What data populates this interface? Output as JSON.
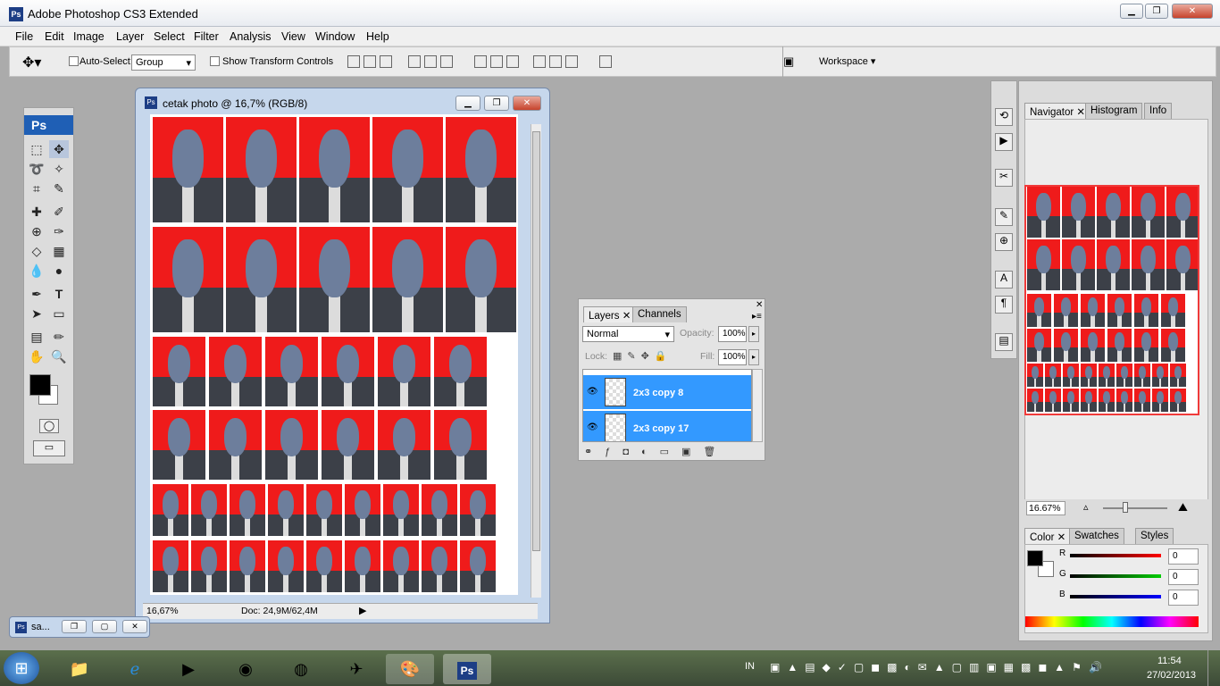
{
  "window": {
    "title": "Adobe Photoshop CS3 Extended",
    "app_icon": "Ps"
  },
  "menu": [
    "File",
    "Edit",
    "Image",
    "Layer",
    "Select",
    "Filter",
    "Analysis",
    "View",
    "Window",
    "Help"
  ],
  "options": {
    "auto_select_label": "Auto-Select:",
    "auto_select_value": "Group",
    "show_transform_label": "Show Transform Controls",
    "workspace_label": "Workspace"
  },
  "toolbox": {
    "logo": "Ps"
  },
  "document": {
    "title": "cetak photo @ 16,7% (RGB/8)",
    "zoom": "16,67%",
    "doc_info": "Doc: 24,9M/62,4M"
  },
  "minimized_doc": {
    "label": "sa..."
  },
  "layers_panel": {
    "tabs": [
      "Layers",
      "Channels"
    ],
    "blend_mode": "Normal",
    "opacity_label": "Opacity:",
    "opacity_value": "100%",
    "lock_label": "Lock:",
    "fill_label": "Fill:",
    "fill_value": "100%",
    "layers": [
      {
        "name": "2x3 copy 8"
      },
      {
        "name": "2x3 copy 17"
      }
    ]
  },
  "navigator_panel": {
    "tabs": [
      "Navigator",
      "Histogram",
      "Info"
    ],
    "zoom": "16.67%"
  },
  "color_panel": {
    "tabs": [
      "Color",
      "Swatches",
      "Styles"
    ],
    "channels": [
      {
        "label": "R",
        "value": "0"
      },
      {
        "label": "G",
        "value": "0"
      },
      {
        "label": "B",
        "value": "0"
      }
    ]
  },
  "taskbar": {
    "lang": "IN",
    "time": "11:54",
    "date": "27/02/2013",
    "ps_label": "Ps"
  },
  "colors": {
    "photo_bg": "#ef1b1b",
    "selection": "#3399ff"
  }
}
